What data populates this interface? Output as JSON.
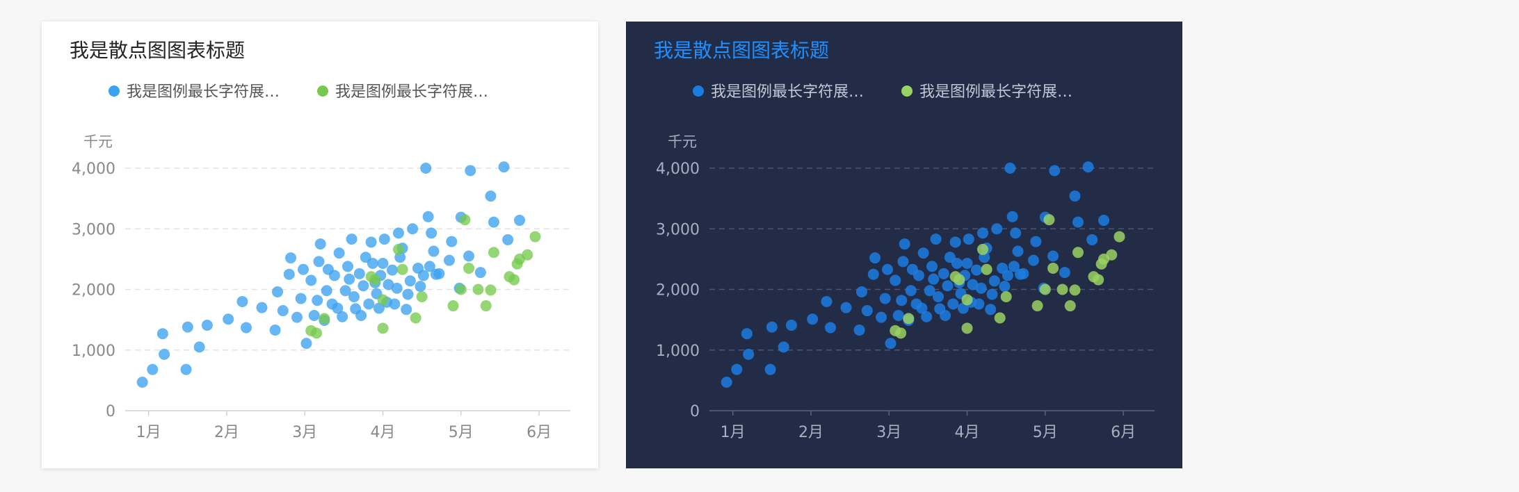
{
  "colors": {
    "page_bg": "#f7f7f7",
    "light_card_bg": "#ffffff",
    "dark_card_bg": "#232c47",
    "series_blue": "#3ba1f1",
    "series_green": "#76c94d",
    "dark_series_blue": "#1c7de0",
    "dark_series_green": "#9ad163",
    "dark_title": "#1e90ff"
  },
  "cards": [
    {
      "theme": "light",
      "title": "我是散点图图表标题",
      "legend": [
        "我是图例最长字符展…",
        "我是图例最长字符展…"
      ],
      "y_unit": "千元",
      "x_ticks": [
        "1月",
        "2月",
        "3月",
        "4月",
        "5月",
        "6月"
      ],
      "y_ticks": [
        "0",
        "1,000",
        "2,000",
        "3,000",
        "4,000"
      ]
    },
    {
      "theme": "dark",
      "title": "我是散点图图表标题",
      "legend": [
        "我是图例最长字符展…",
        "我是图例最长字符展…"
      ],
      "y_unit": "千元",
      "x_ticks": [
        "1月",
        "2月",
        "3月",
        "4月",
        "5月",
        "6月"
      ],
      "y_ticks": [
        "0",
        "1,000",
        "2,000",
        "3,000",
        "4,000"
      ]
    }
  ],
  "chart_data": {
    "type": "scatter",
    "x_unit": "month",
    "xlim": [
      0.7,
      6.4
    ],
    "ylim": [
      0,
      4000
    ],
    "ylabel": "千元",
    "grid": true,
    "legend_position": "top",
    "series": [
      {
        "name": "我是图例最长字符展…",
        "points": [
          [
            0.92,
            470
          ],
          [
            1.05,
            680
          ],
          [
            1.18,
            1270
          ],
          [
            1.2,
            930
          ],
          [
            1.48,
            680
          ],
          [
            1.5,
            1380
          ],
          [
            1.65,
            1050
          ],
          [
            1.75,
            1410
          ],
          [
            2.02,
            1510
          ],
          [
            2.2,
            1800
          ],
          [
            2.25,
            1370
          ],
          [
            2.45,
            1700
          ],
          [
            2.62,
            1330
          ],
          [
            2.72,
            1650
          ],
          [
            2.65,
            1960
          ],
          [
            2.8,
            2250
          ],
          [
            2.82,
            2520
          ],
          [
            2.9,
            1540
          ],
          [
            2.95,
            1850
          ],
          [
            2.98,
            2330
          ],
          [
            3.02,
            1110
          ],
          [
            3.08,
            2150
          ],
          [
            3.12,
            1570
          ],
          [
            3.16,
            1820
          ],
          [
            3.18,
            2460
          ],
          [
            3.2,
            2750
          ],
          [
            3.25,
            1490
          ],
          [
            3.28,
            1980
          ],
          [
            3.3,
            2330
          ],
          [
            3.35,
            1760
          ],
          [
            3.38,
            2230
          ],
          [
            3.42,
            1690
          ],
          [
            3.44,
            2600
          ],
          [
            3.48,
            1550
          ],
          [
            3.52,
            1980
          ],
          [
            3.55,
            2380
          ],
          [
            3.57,
            2170
          ],
          [
            3.6,
            2830
          ],
          [
            3.63,
            1880
          ],
          [
            3.65,
            1680
          ],
          [
            3.7,
            2260
          ],
          [
            3.72,
            1570
          ],
          [
            3.75,
            2060
          ],
          [
            3.78,
            2530
          ],
          [
            3.82,
            1760
          ],
          [
            3.85,
            2780
          ],
          [
            3.87,
            2430
          ],
          [
            3.9,
            2110
          ],
          [
            3.92,
            1930
          ],
          [
            3.95,
            1690
          ],
          [
            3.97,
            2230
          ],
          [
            4.0,
            2430
          ],
          [
            4.02,
            2830
          ],
          [
            4.05,
            1790
          ],
          [
            4.07,
            2080
          ],
          [
            4.12,
            2320
          ],
          [
            4.15,
            1760
          ],
          [
            4.18,
            2020
          ],
          [
            4.2,
            2930
          ],
          [
            4.22,
            2530
          ],
          [
            4.25,
            2680
          ],
          [
            4.3,
            1670
          ],
          [
            4.32,
            1920
          ],
          [
            4.35,
            2140
          ],
          [
            4.38,
            3000
          ],
          [
            4.45,
            2350
          ],
          [
            4.48,
            2050
          ],
          [
            4.52,
            2230
          ],
          [
            4.55,
            4000
          ],
          [
            4.58,
            3200
          ],
          [
            4.6,
            2380
          ],
          [
            4.62,
            2930
          ],
          [
            4.65,
            2630
          ],
          [
            4.68,
            2250
          ],
          [
            4.72,
            2260
          ],
          [
            4.85,
            2480
          ],
          [
            4.88,
            2790
          ],
          [
            4.98,
            2020
          ],
          [
            5.0,
            3190
          ],
          [
            5.1,
            2550
          ],
          [
            5.12,
            3960
          ],
          [
            5.25,
            2280
          ],
          [
            5.38,
            3540
          ],
          [
            5.42,
            3110
          ],
          [
            5.55,
            4020
          ],
          [
            5.6,
            2820
          ],
          [
            5.75,
            3140
          ]
        ]
      },
      {
        "name": "我是图例最长字符展…",
        "points": [
          [
            3.08,
            1320
          ],
          [
            3.15,
            1280
          ],
          [
            3.25,
            1520
          ],
          [
            3.85,
            2210
          ],
          [
            3.9,
            2160
          ],
          [
            4.0,
            1830
          ],
          [
            4.0,
            1360
          ],
          [
            4.2,
            2660
          ],
          [
            4.25,
            2330
          ],
          [
            4.42,
            1530
          ],
          [
            4.5,
            1880
          ],
          [
            4.9,
            1730
          ],
          [
            5.0,
            2000
          ],
          [
            5.05,
            3150
          ],
          [
            5.1,
            2350
          ],
          [
            5.22,
            2000
          ],
          [
            5.32,
            1730
          ],
          [
            5.38,
            1990
          ],
          [
            5.42,
            2610
          ],
          [
            5.62,
            2210
          ],
          [
            5.68,
            2160
          ],
          [
            5.72,
            2420
          ],
          [
            5.75,
            2500
          ],
          [
            5.85,
            2570
          ],
          [
            5.95,
            2870
          ]
        ]
      }
    ]
  }
}
